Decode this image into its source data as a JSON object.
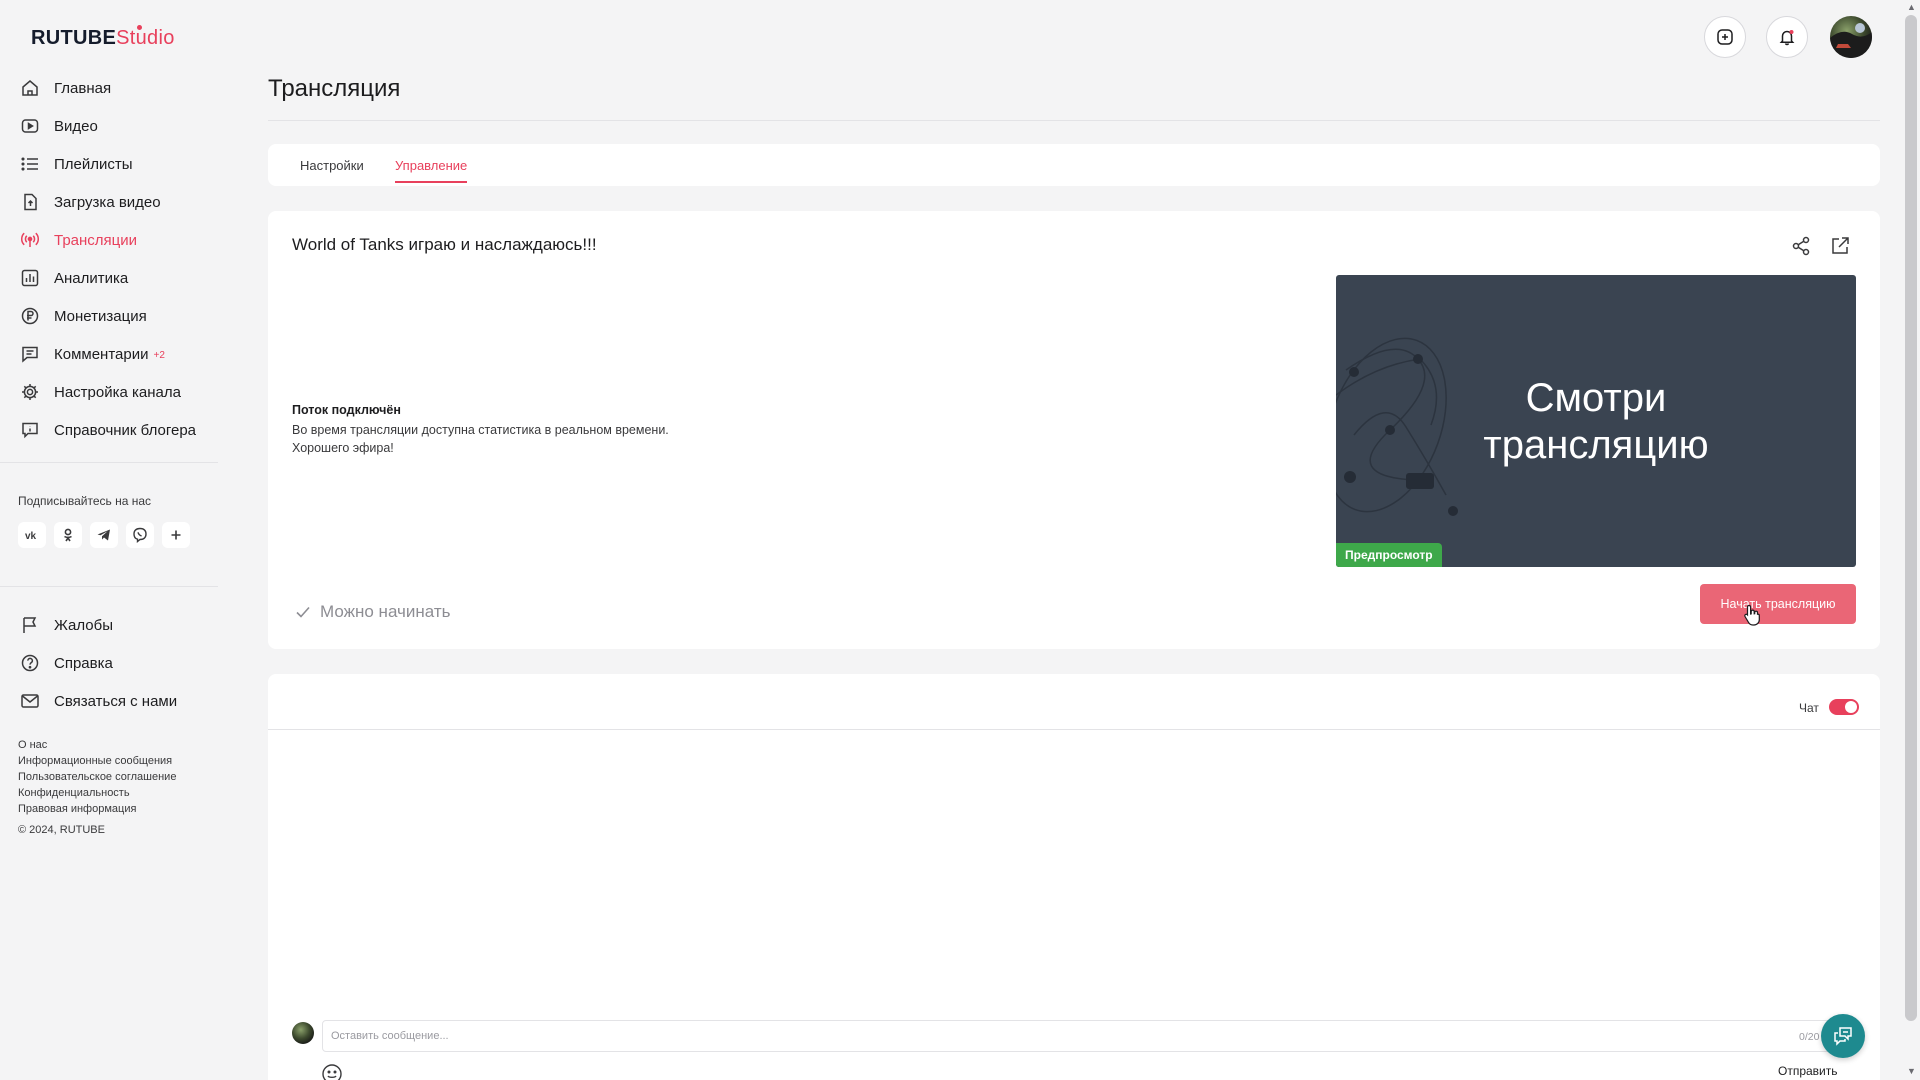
{
  "brand": {
    "rutube": "RUTUBE",
    "studio": "Studio",
    "accent": "#e8405c"
  },
  "sidebar": {
    "items": [
      {
        "label": "Главная",
        "icon": "home-icon"
      },
      {
        "label": "Видео",
        "icon": "video-icon"
      },
      {
        "label": "Плейлисты",
        "icon": "playlist-icon"
      },
      {
        "label": "Загрузка видео",
        "icon": "upload-file-icon"
      },
      {
        "label": "Трансляции",
        "icon": "broadcast-icon",
        "active": true
      },
      {
        "label": "Аналитика",
        "icon": "analytics-icon"
      },
      {
        "label": "Монетизация",
        "icon": "ruble-icon"
      },
      {
        "label": "Комментарии",
        "icon": "comment-icon",
        "badge": "+2"
      },
      {
        "label": "Настройка канала",
        "icon": "gear-icon"
      },
      {
        "label": "Справочник блогера",
        "icon": "info-book-icon"
      }
    ],
    "social_title": "Подписывайтесь на нас",
    "social": [
      {
        "name": "vk-icon",
        "glyph": "vk"
      },
      {
        "name": "odnoklassniki-icon",
        "glyph": "ок"
      },
      {
        "name": "telegram-icon",
        "glyph": "tg"
      },
      {
        "name": "viber-icon",
        "glyph": "vb"
      },
      {
        "name": "plus-icon",
        "glyph": "+"
      }
    ],
    "secondary": [
      {
        "label": "Жалобы",
        "icon": "flag-icon"
      },
      {
        "label": "Справка",
        "icon": "help-icon"
      },
      {
        "label": "Связаться с нами",
        "icon": "mail-icon"
      }
    ],
    "footer_links": [
      "О нас",
      "Информационные сообщения",
      "Пользовательское соглашение",
      "Конфиденциальность",
      "Правовая информация"
    ],
    "copyright": "© 2024, RUTUBE"
  },
  "page": {
    "title": "Трансляция"
  },
  "tabs": [
    {
      "label": "Настройки",
      "active": false
    },
    {
      "label": "Управление",
      "active": true
    }
  ],
  "stream": {
    "title": "World of Tanks играю и наслаждаюсь!!!",
    "status_title": "Поток подключён",
    "status_line1": "Во время трансляции доступна статистика в реальном времени.",
    "status_line2": "Хорошего эфира!",
    "preview_line1": "Смотри",
    "preview_line2": "трансляцию",
    "preview_badge": "Предпросмотр",
    "ready_text": "Можно начинать",
    "start_button": "Начать трансляцию"
  },
  "chat": {
    "label": "Чат",
    "enabled": true,
    "placeholder": "Оставить сообщение...",
    "counter": "0/20",
    "send": "Отправить"
  }
}
